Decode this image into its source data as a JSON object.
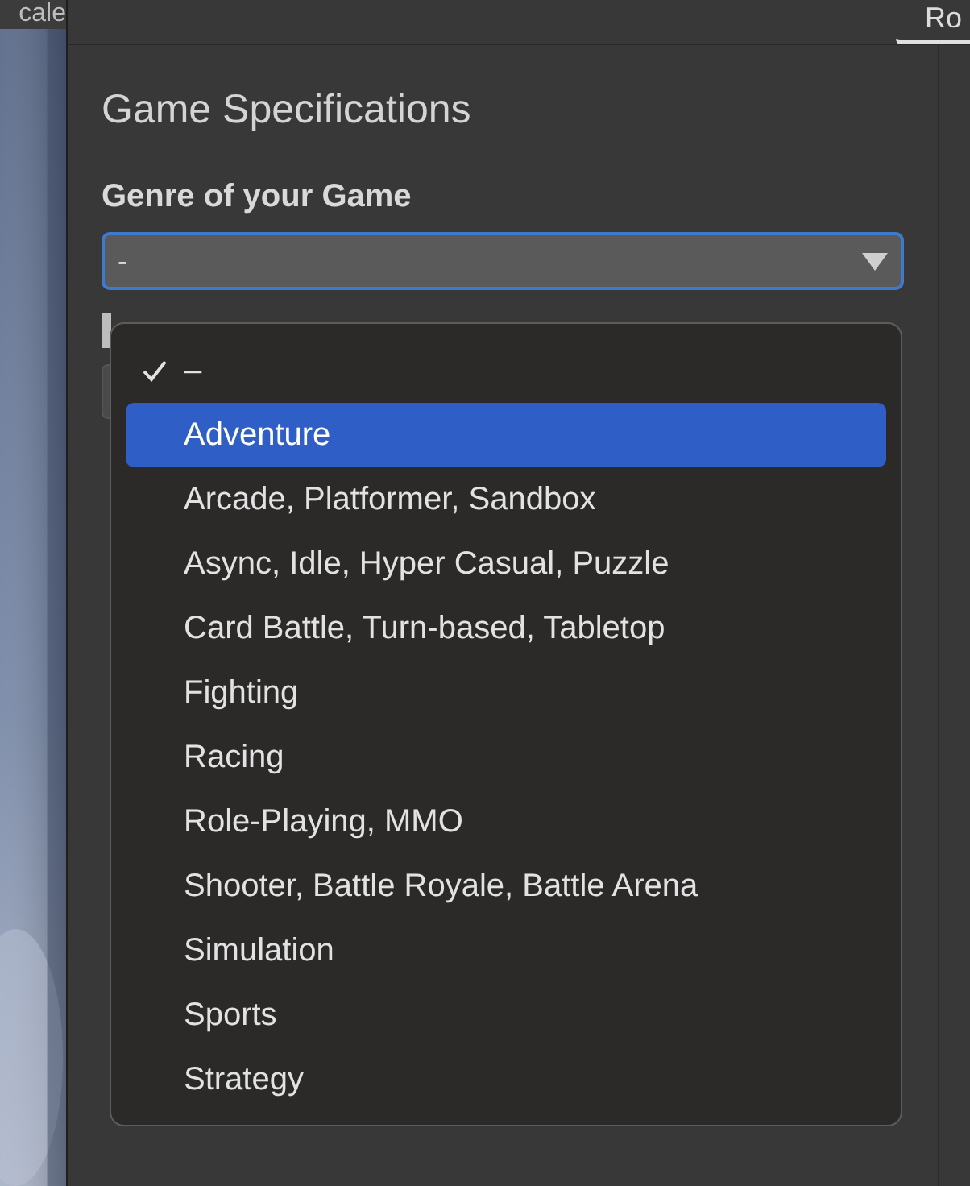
{
  "left_tab": {
    "label": "cale"
  },
  "top_tab": {
    "label": "Ro",
    "selected": true
  },
  "section_title": "Game Specifications",
  "genre_field": {
    "label": "Genre of your Game",
    "value": "-",
    "focused": true
  },
  "menu": {
    "items": [
      {
        "label": "–",
        "checked": true,
        "selected": false
      },
      {
        "label": "Adventure",
        "checked": false,
        "selected": true
      },
      {
        "label": "Arcade, Platformer, Sandbox",
        "checked": false,
        "selected": false
      },
      {
        "label": "Async, Idle, Hyper Casual, Puzzle",
        "checked": false,
        "selected": false
      },
      {
        "label": "Card Battle, Turn-based, Tabletop",
        "checked": false,
        "selected": false
      },
      {
        "label": "Fighting",
        "checked": false,
        "selected": false
      },
      {
        "label": "Racing",
        "checked": false,
        "selected": false
      },
      {
        "label": "Role-Playing, MMO",
        "checked": false,
        "selected": false
      },
      {
        "label": "Shooter, Battle Royale, Battle Arena",
        "checked": false,
        "selected": false
      },
      {
        "label": "Simulation",
        "checked": false,
        "selected": false
      },
      {
        "label": "Sports",
        "checked": false,
        "selected": false
      },
      {
        "label": "Strategy",
        "checked": false,
        "selected": false
      }
    ]
  }
}
